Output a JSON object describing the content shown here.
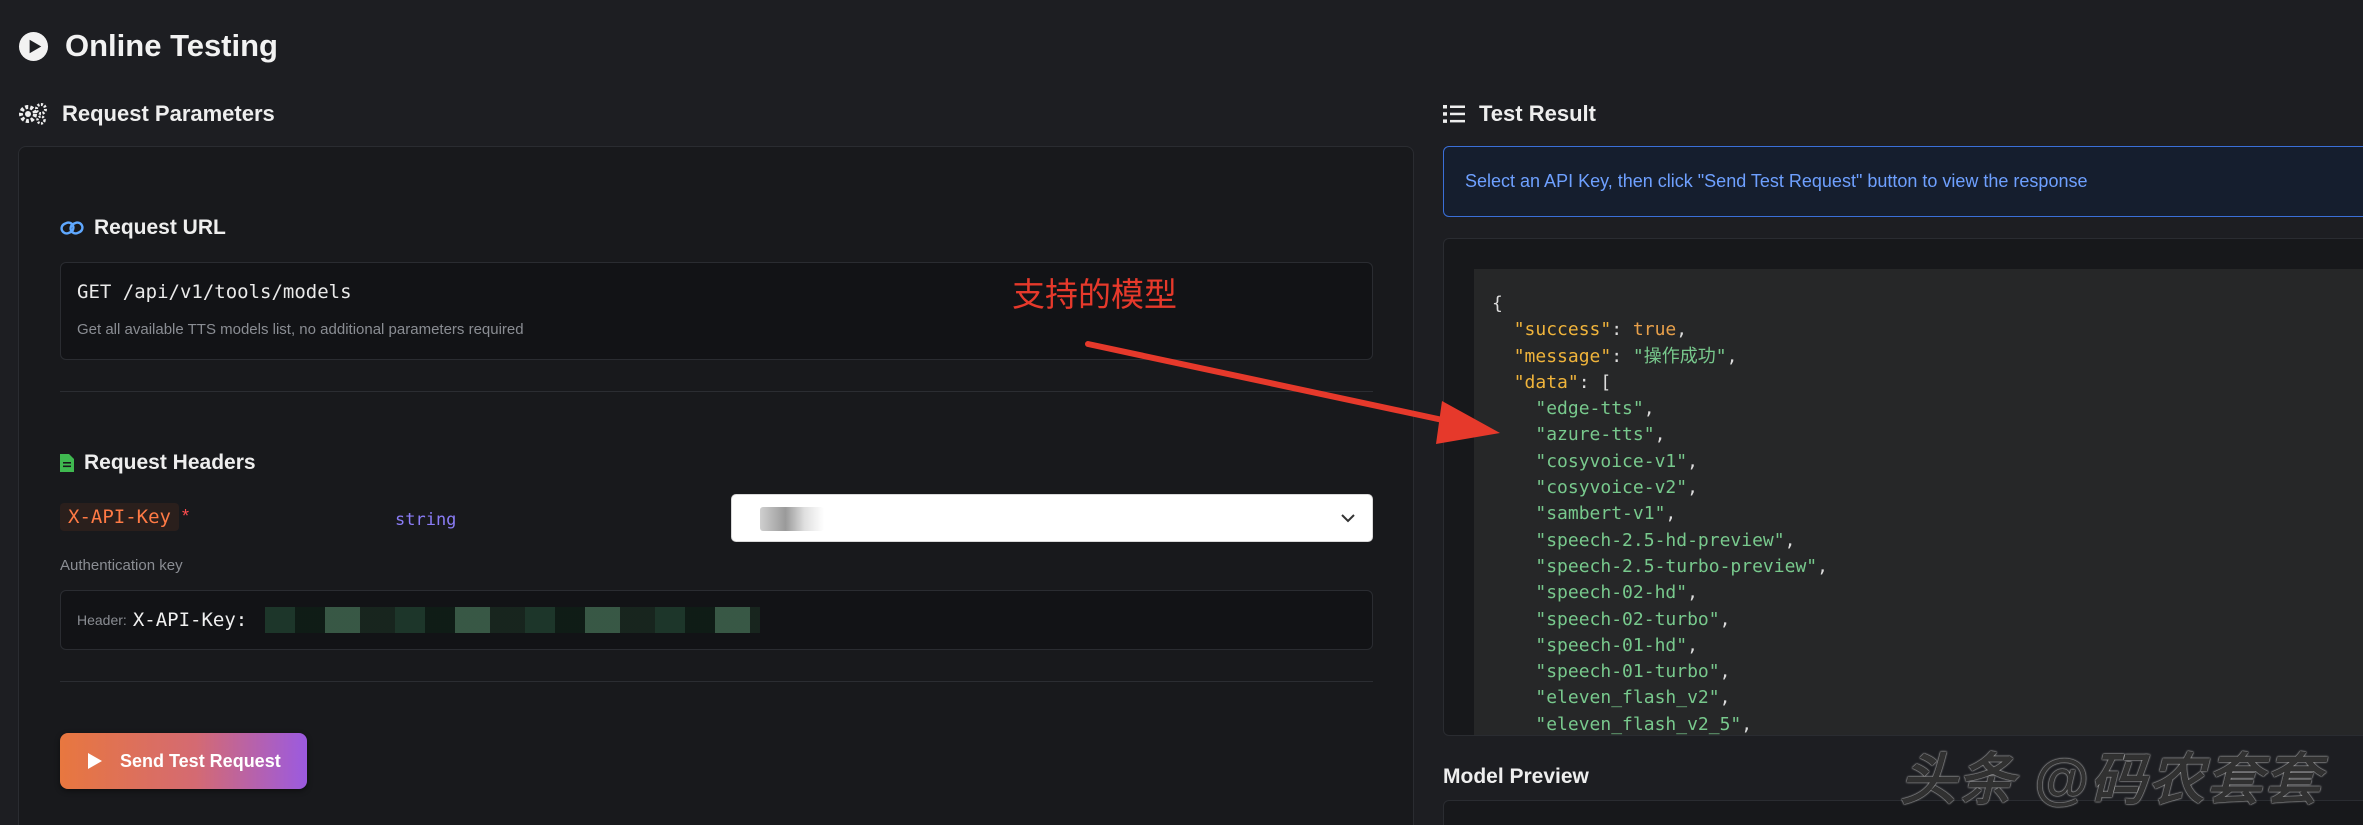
{
  "page": {
    "title": "Online Testing"
  },
  "sections": {
    "request_params": "Request Parameters",
    "test_result": "Test Result",
    "model_preview": "Model Preview"
  },
  "request_url": {
    "title": "Request URL",
    "method_path": "GET /api/v1/tools/models",
    "description": "Get all available TTS models list, no additional parameters required"
  },
  "request_headers": {
    "title": "Request Headers",
    "key": "X-API-Key",
    "required_mark": "*",
    "type": "string",
    "description": "Authentication key",
    "preview_prefix": "Header:",
    "preview_key": "X-API-Key:"
  },
  "send_button": {
    "label": "Send Test Request"
  },
  "result": {
    "info": "Select an API Key, then click \"Send Test Request\" button to view the response",
    "json": {
      "open": "{",
      "success_key": "\"success\"",
      "success_val": "true",
      "message_key": "\"message\"",
      "message_val": "\"操作成功\"",
      "data_key": "\"data\"",
      "data_open": "[",
      "models": [
        "\"edge-tts\"",
        "\"azure-tts\"",
        "\"cosyvoice-v1\"",
        "\"cosyvoice-v2\"",
        "\"sambert-v1\"",
        "\"speech-2.5-hd-preview\"",
        "\"speech-2.5-turbo-preview\"",
        "\"speech-02-hd\"",
        "\"speech-02-turbo\"",
        "\"speech-01-hd\"",
        "\"speech-01-turbo\"",
        "\"eleven_flash_v2\"",
        "\"eleven_flash_v2_5\""
      ]
    }
  },
  "annotation": {
    "text": "支持的模型",
    "color": "#e6392b"
  },
  "watermark": {
    "text": "头条 @码农套套"
  },
  "colors": {
    "background": "#1d1e22",
    "info_text": "#6ea0ff",
    "json_key": "#f0b43b",
    "json_string": "#78c98d",
    "header_key": "#ff7a45",
    "type_label": "#8a7cf5"
  }
}
